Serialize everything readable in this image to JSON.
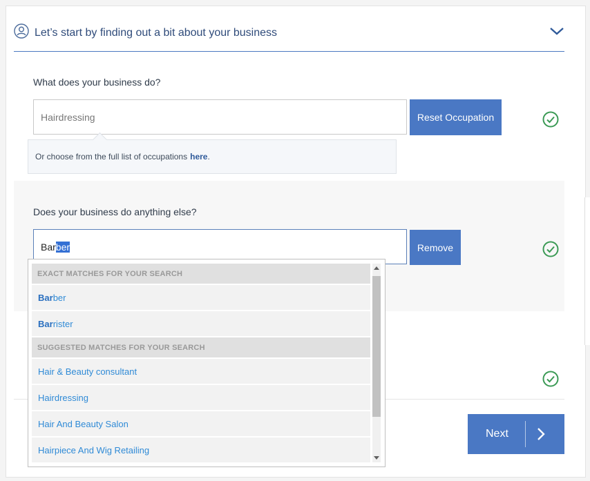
{
  "header": {
    "title": "Let’s start by finding out a bit about your business"
  },
  "q1": {
    "question": "What does your business do?",
    "value": "Hairdressing",
    "button": "Reset Occupation",
    "hint_text": "Or choose from the full list of occupations",
    "hint_link": "here",
    "hint_period": "."
  },
  "q2": {
    "question": "Does your business do anything else?",
    "value_typed": "Bar",
    "value_autocomplete": "ber",
    "button": "Remove"
  },
  "dropdown": {
    "exact_header": "EXACT MATCHES FOR YOUR SEARCH",
    "exact": [
      {
        "match": "Bar",
        "rest": "ber"
      },
      {
        "match": "Bar",
        "rest": "rister"
      }
    ],
    "suggested_header": "SUGGESTED MATCHES FOR YOUR SEARCH",
    "suggested": [
      "Hair & Beauty consultant",
      "Hairdressing",
      "Hair And Beauty Salon",
      "Hairpiece And Wig Retailing"
    ]
  },
  "footer": {
    "next_label": "Next"
  },
  "colors": {
    "accent": "#4a78c4",
    "check": "#3b9a55",
    "link": "#2f8ad6"
  }
}
